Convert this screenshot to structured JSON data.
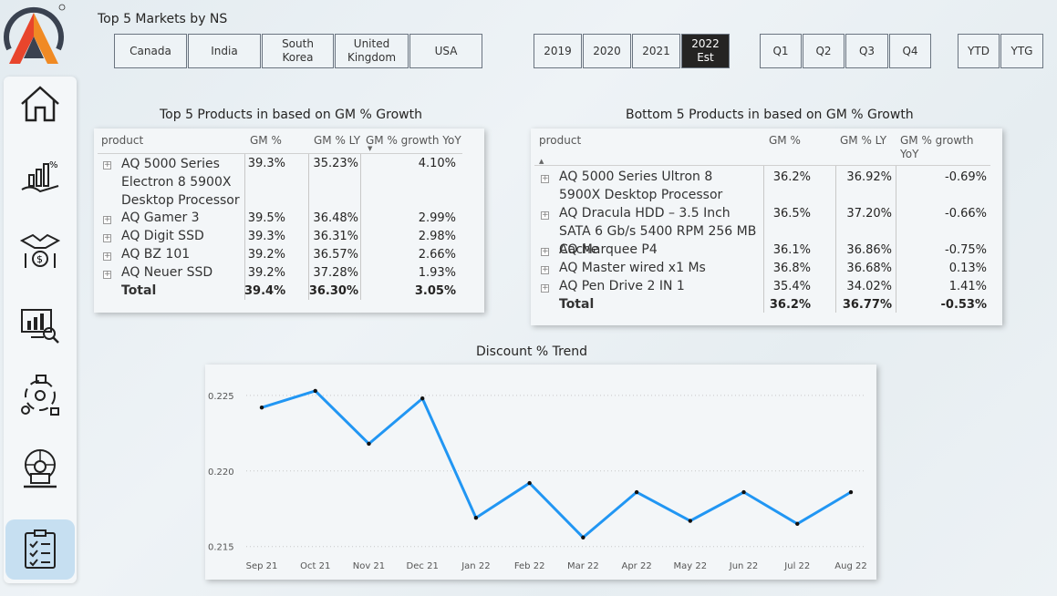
{
  "header": {
    "markets_title": "Top 5 Markets by NS"
  },
  "markets": [
    "Canada",
    "India",
    "South Korea",
    "United Kingdom",
    "USA"
  ],
  "years": [
    {
      "label": "2019",
      "selected": false
    },
    {
      "label": "2020",
      "selected": false
    },
    {
      "label": "2021",
      "selected": false
    },
    {
      "label": "2022 Est",
      "selected": true
    }
  ],
  "quarters": [
    "Q1",
    "Q2",
    "Q3",
    "Q4"
  ],
  "periods": [
    "YTD",
    "YTG"
  ],
  "top_table": {
    "title": "Top 5 Products in  based on GM % Growth",
    "headers": [
      "product",
      "GM %",
      "GM % LY",
      "GM % growth YoY"
    ],
    "rows": [
      {
        "product": "AQ 5000 Series Electron 8 5900X Desktop Processor",
        "gm": "39.3%",
        "gm_ly": "35.23%",
        "growth": "4.10%"
      },
      {
        "product": "AQ Gamer 3",
        "gm": "39.5%",
        "gm_ly": "36.48%",
        "growth": "2.99%"
      },
      {
        "product": "AQ Digit SSD",
        "gm": "39.3%",
        "gm_ly": "36.31%",
        "growth": "2.98%"
      },
      {
        "product": "AQ BZ 101",
        "gm": "39.2%",
        "gm_ly": "36.57%",
        "growth": "2.66%"
      },
      {
        "product": "AQ Neuer SSD",
        "gm": "39.2%",
        "gm_ly": "37.28%",
        "growth": "1.93%"
      }
    ],
    "total": {
      "label": "Total",
      "gm": "39.4%",
      "gm_ly": "36.30%",
      "growth": "3.05%"
    }
  },
  "bottom_table": {
    "title": "Bottom 5 Products in  based on GM % Growth",
    "headers": [
      "product",
      "GM %",
      "GM % LY",
      "GM % growth YoY"
    ],
    "rows": [
      {
        "product": "AQ 5000 Series Ultron 8 5900X Desktop Processor",
        "gm": "36.2%",
        "gm_ly": "36.92%",
        "growth": "-0.69%"
      },
      {
        "product": "AQ Dracula HDD – 3.5 Inch SATA 6 Gb/s 5400 RPM 256 MB Cache",
        "gm": "36.5%",
        "gm_ly": "37.20%",
        "growth": "-0.66%"
      },
      {
        "product": "AQ Marquee P4",
        "gm": "36.1%",
        "gm_ly": "36.86%",
        "growth": "-0.75%"
      },
      {
        "product": "AQ Master wired x1 Ms",
        "gm": "36.8%",
        "gm_ly": "36.68%",
        "growth": "0.13%"
      },
      {
        "product": "AQ Pen Drive 2 IN 1",
        "gm": "35.4%",
        "gm_ly": "34.02%",
        "growth": "1.41%"
      }
    ],
    "total": {
      "label": "Total",
      "gm": "36.2%",
      "gm_ly": "36.77%",
      "growth": "-0.53%"
    }
  },
  "sidebar": {
    "items": [
      "home-icon",
      "finance-growth-icon",
      "money-handshake-icon",
      "analytics-monitor-icon",
      "supply-chain-icon",
      "global-executive-icon",
      "checklist-icon"
    ],
    "active_index": 6
  },
  "chart_data": {
    "type": "line",
    "title": "Discount % Trend",
    "x": [
      "Sep 21",
      "Oct 21",
      "Nov 21",
      "Dec 21",
      "Jan 22",
      "Feb 22",
      "Mar 22",
      "Apr 22",
      "May 22",
      "Jun 22",
      "Jul 22",
      "Aug 22"
    ],
    "series": [
      {
        "values": [
          0.2242,
          0.2253,
          0.2218,
          0.2248,
          0.2169,
          0.2192,
          0.2156,
          0.2186,
          0.2167,
          0.2186,
          0.2165,
          0.2186
        ]
      }
    ],
    "yticks": [
      "0.225",
      "0.220",
      "0.215"
    ],
    "ylim": [
      0.2145,
      0.2262
    ],
    "grid": true,
    "color": "#2196f3"
  }
}
